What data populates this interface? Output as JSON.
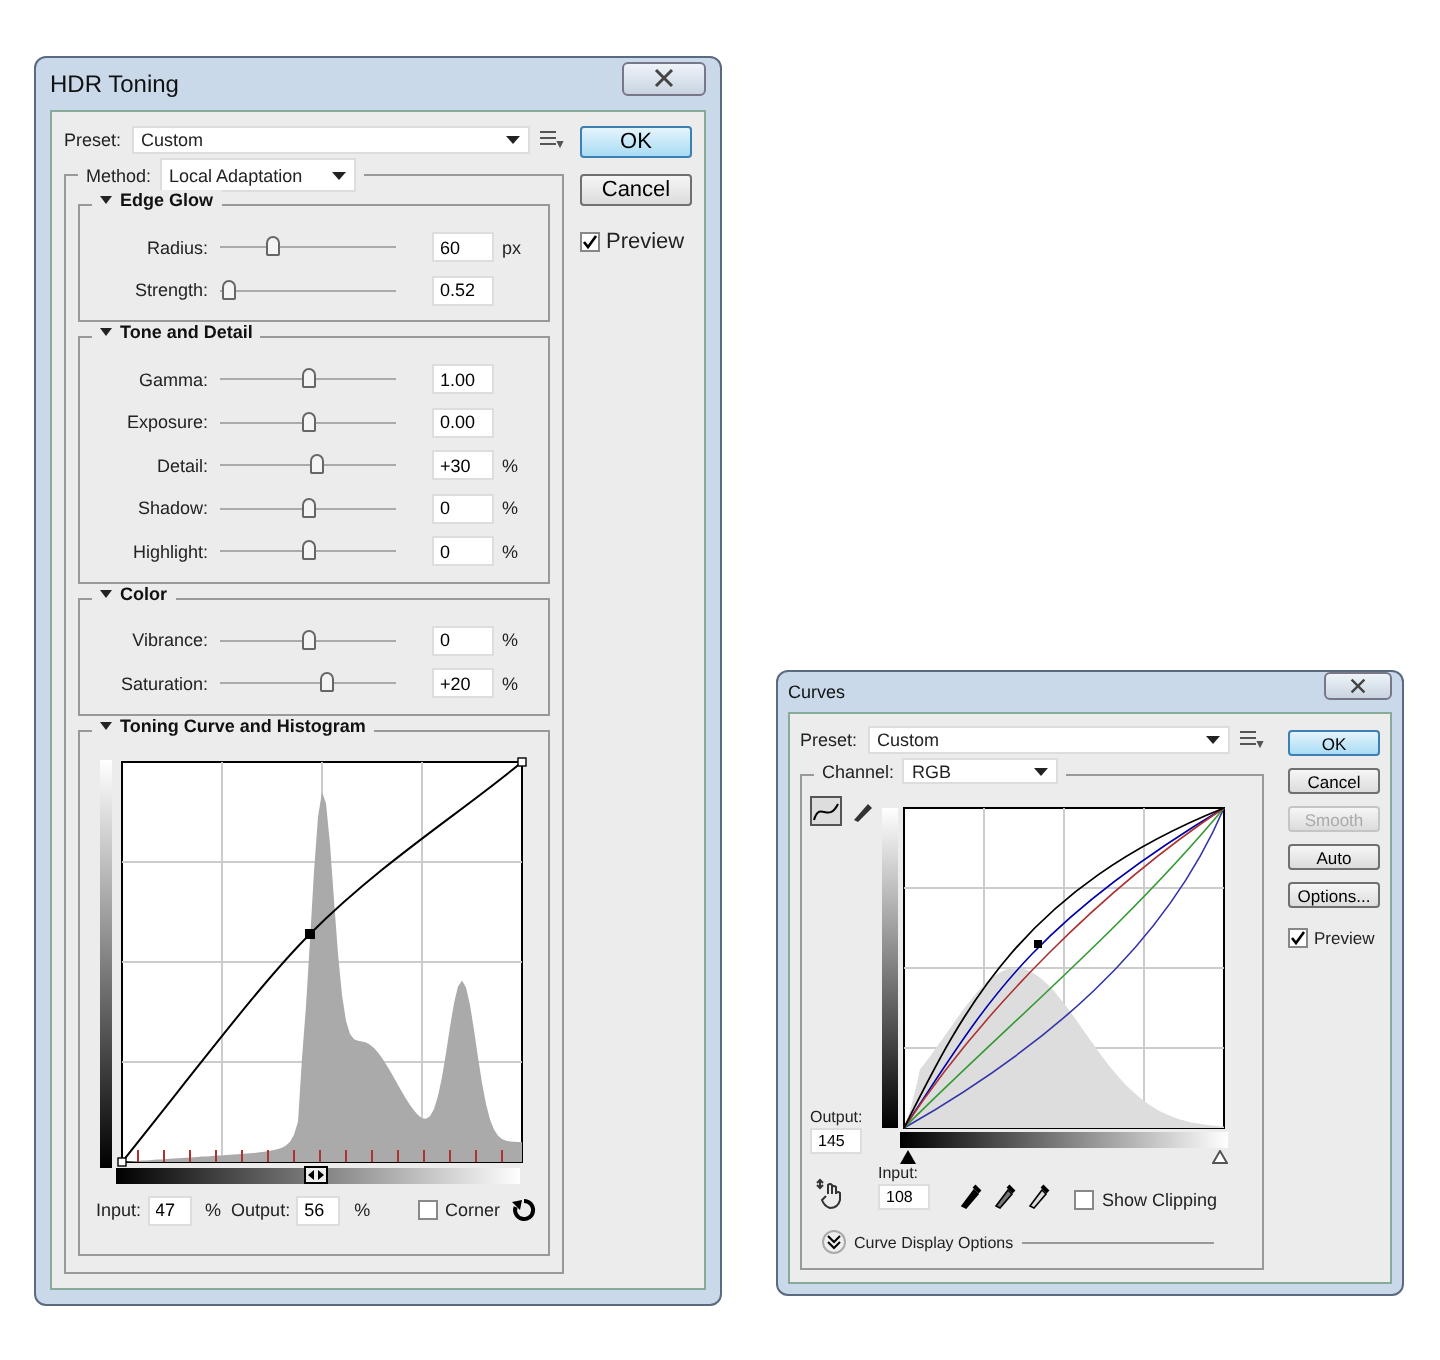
{
  "hdr_dialog": {
    "title": "HDR Toning",
    "preset": {
      "label": "Preset:",
      "value": "Custom"
    },
    "method": {
      "label": "Method:",
      "value": "Local Adaptation"
    },
    "sections": [
      {
        "title": "Edge Glow",
        "expanded": true,
        "rows": [
          {
            "label": "Radius:",
            "level": 0.3,
            "value": "60",
            "unit": "px"
          },
          {
            "label": "Strength:",
            "level": 0.05,
            "value": "0.52"
          }
        ]
      },
      {
        "title": "Tone and Detail",
        "expanded": true,
        "rows": [
          {
            "label": "Gamma:",
            "level": 0.5,
            "value": "1.00"
          },
          {
            "label": "Exposure:",
            "level": 0.5,
            "value": "0.00"
          },
          {
            "label": "Detail:",
            "level": 0.55,
            "value": "+30",
            "unit": "%"
          },
          {
            "label": "Shadow:",
            "level": 0.5,
            "value": "0",
            "unit": "%"
          },
          {
            "label": "Highlight:",
            "level": 0.5,
            "value": "0",
            "unit": "%"
          }
        ]
      },
      {
        "title": "Color",
        "expanded": true,
        "rows": [
          {
            "label": "Vibrance:",
            "level": 0.5,
            "value": "0",
            "unit": "%"
          },
          {
            "label": "Saturation:",
            "level": 0.6,
            "value": "+20",
            "unit": "%"
          }
        ]
      }
    ],
    "curve_section": {
      "title": "Toning Curve and Histogram",
      "expanded": true,
      "input": {
        "label": "Input:",
        "value": "47",
        "unit": "%"
      },
      "output": {
        "label": "Output:",
        "value": "56",
        "unit": "%"
      },
      "corner": {
        "label": "Corner",
        "checked": false
      }
    },
    "buttons": [
      {
        "label": "OK",
        "default": true
      },
      {
        "label": "Cancel",
        "default": false
      }
    ],
    "preview": {
      "label": "Preview",
      "checked": true
    }
  },
  "curves_dialog": {
    "title": "Curves",
    "preset": {
      "label": "Preset:",
      "value": "Custom"
    },
    "channel": {
      "label": "Channel:",
      "value": "RGB"
    },
    "tools": [
      {
        "kind": "curve",
        "selected": true
      },
      {
        "kind": "pencil",
        "selected": false
      }
    ],
    "output": {
      "label": "Output:",
      "value": "145"
    },
    "input": {
      "label": "Input:",
      "value": "108"
    },
    "show_clipping": {
      "label": "Show Clipping",
      "checked": false
    },
    "display_options": {
      "label": "Curve Display Options",
      "expanded": false
    },
    "buttons": [
      {
        "label": "OK",
        "default": true,
        "disabled": false
      },
      {
        "label": "Cancel",
        "default": false,
        "disabled": false
      },
      {
        "label": "Smooth",
        "default": false,
        "disabled": true
      },
      {
        "label": "Auto",
        "default": false,
        "disabled": false
      },
      {
        "label": "Options...",
        "default": false,
        "disabled": false
      }
    ],
    "preview": {
      "label": "Preview",
      "checked": true
    }
  }
}
